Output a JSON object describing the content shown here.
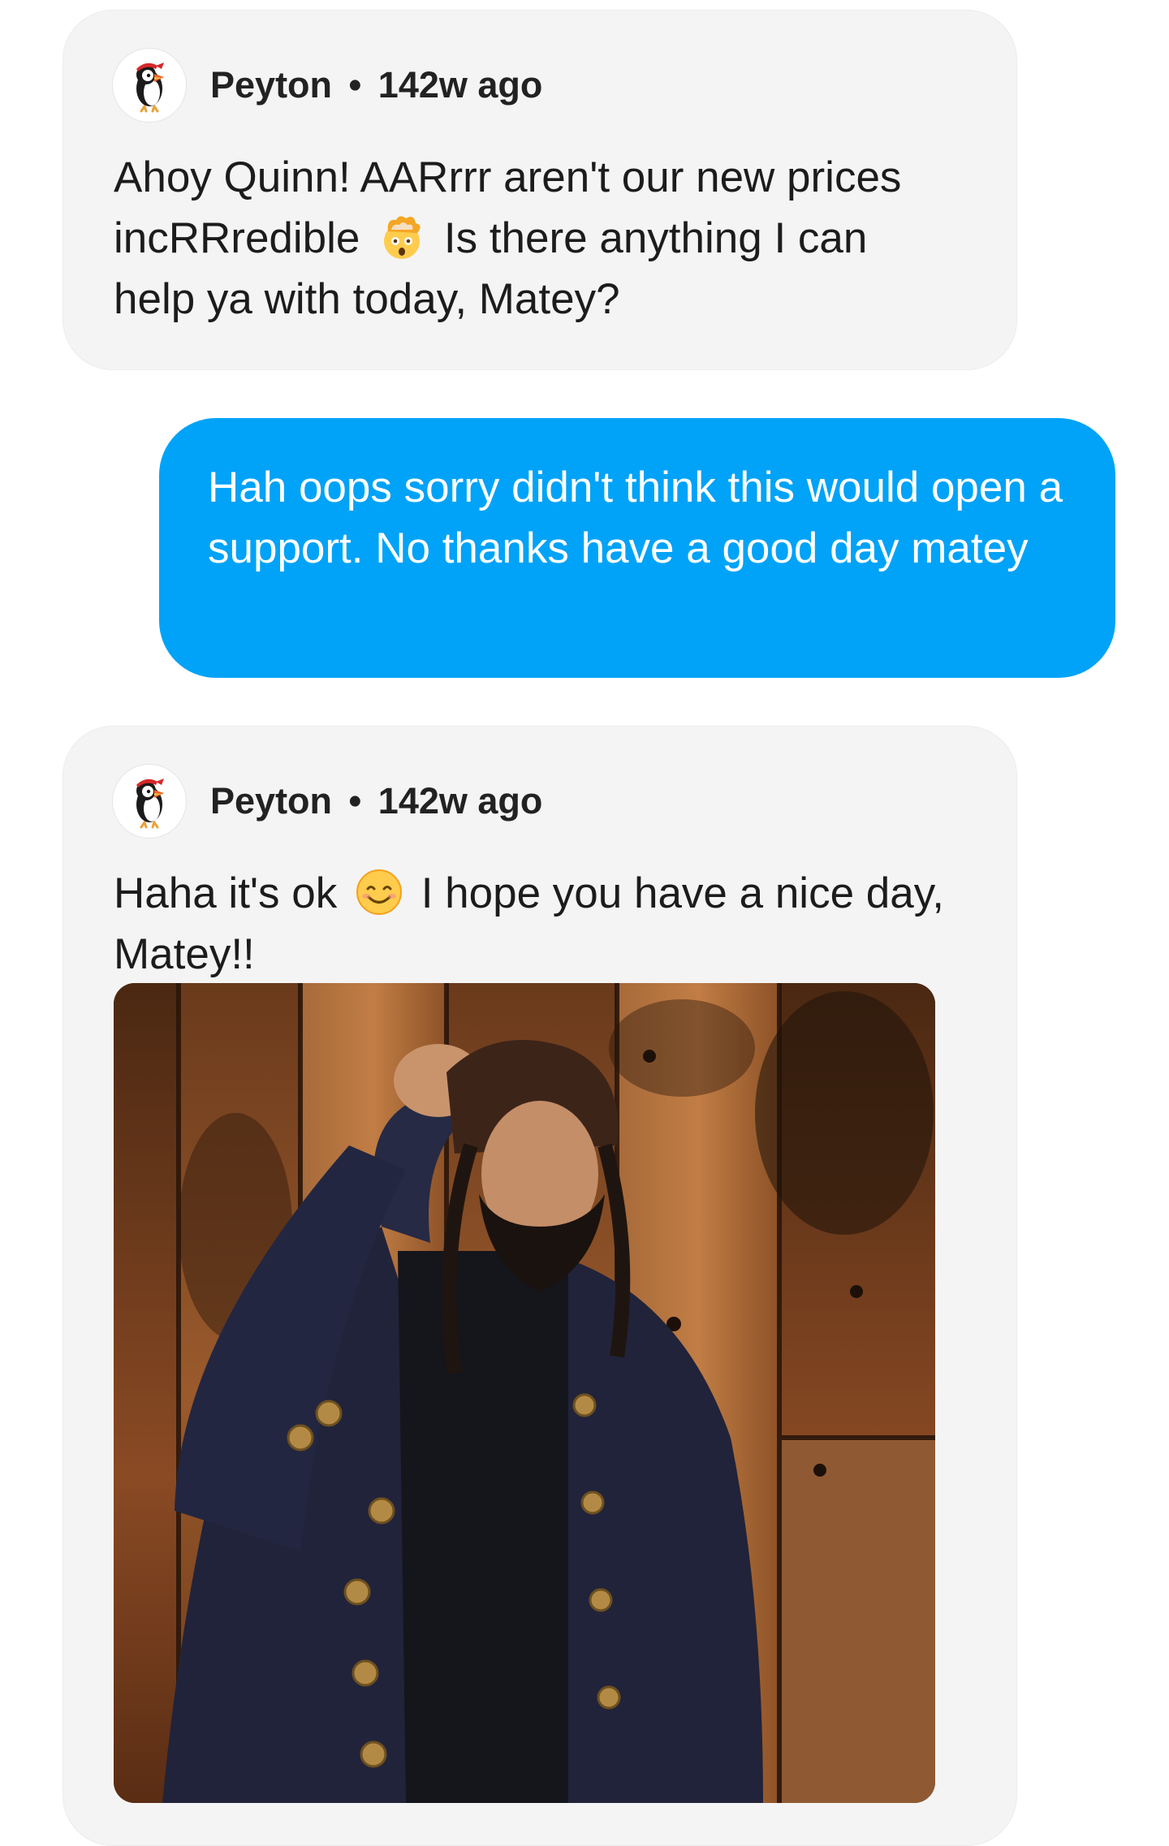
{
  "messages": [
    {
      "sender": "Peyton",
      "separator": "•",
      "time": "142w ago",
      "text_a": "Ahoy Quinn! AARrrr aren't our new prices incRRredible",
      "emoji": "exploding-head-emoji",
      "text_b": "Is there anything I can help ya with today, Matey?"
    },
    {
      "text": "Hah oops sorry didn't think this would open a support. No thanks have a good day matey"
    },
    {
      "sender": "Peyton",
      "separator": "•",
      "time": "142w ago",
      "text_a": "Haha it's ok",
      "emoji": "smiling-face-emoji",
      "text_b": "I hope you have a nice day, Matey!!",
      "image": "pirate-costume-photo"
    }
  ],
  "colors": {
    "incoming_bubble": "#f4f4f5",
    "outgoing_bubble": "#00a3f7",
    "outgoing_text": "#ffffff"
  },
  "icons": {
    "avatar": "puffin-pirate-icon"
  }
}
